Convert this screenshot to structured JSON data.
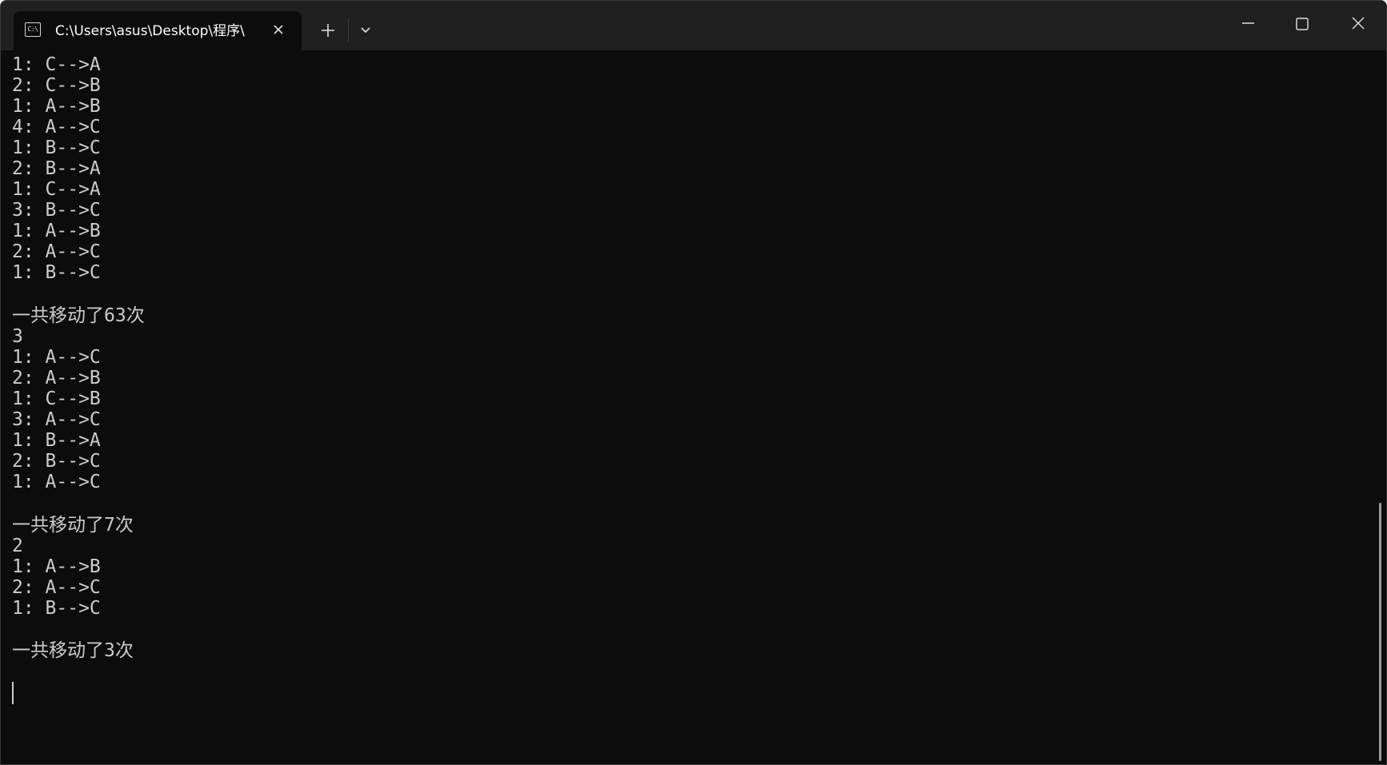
{
  "tab": {
    "icon": "terminal-cmd-icon",
    "icon_text": "C:\\",
    "title": "C:\\Users\\asus\\Desktop\\程序\\"
  },
  "icons": {
    "close_tab": "close-icon",
    "new_tab": "plus-icon",
    "dropdown": "chevron-down-icon",
    "minimize": "minimize-icon",
    "maximize": "maximize-icon",
    "close_window": "close-icon"
  },
  "colors": {
    "terminal_bg": "#0c0c0c",
    "titlebar_bg": "#202020",
    "text": "#cccccc"
  },
  "terminal": {
    "lines": [
      "1: C-->A",
      "2: C-->B",
      "1: A-->B",
      "4: A-->C",
      "1: B-->C",
      "2: B-->A",
      "1: C-->A",
      "3: B-->C",
      "1: A-->B",
      "2: A-->C",
      "1: B-->C",
      "",
      "一共移动了63次",
      "3",
      "1: A-->C",
      "2: A-->B",
      "1: C-->B",
      "3: A-->C",
      "1: B-->A",
      "2: B-->C",
      "1: A-->C",
      "",
      "一共移动了7次",
      "2",
      "1: A-->B",
      "2: A-->C",
      "1: B-->C",
      "",
      "一共移动了3次"
    ]
  }
}
